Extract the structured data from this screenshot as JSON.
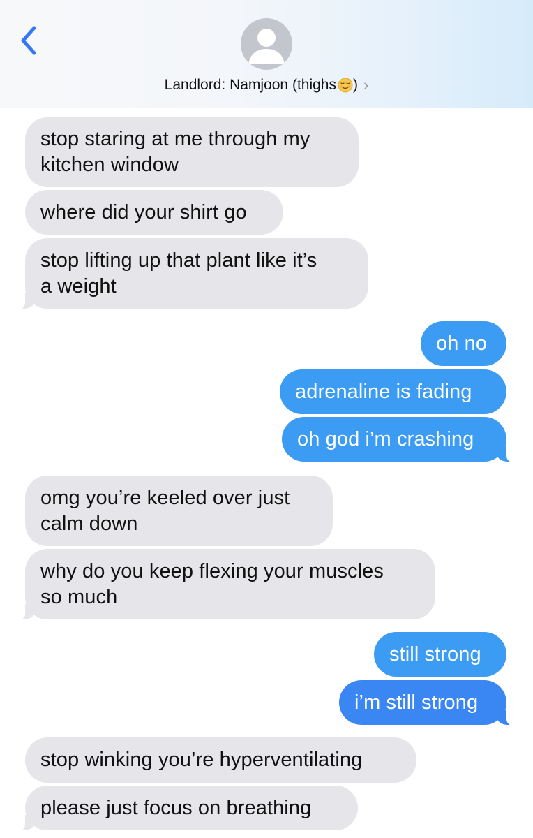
{
  "header": {
    "back_icon": "chevron-left-icon",
    "avatar_icon": "person-silhouette-icon",
    "contact_name": "Landlord: Namjoon (thighs",
    "contact_suffix": ")",
    "emoji": "relieved-face-emoji",
    "disclosure_icon": "chevron-right-icon",
    "disclosure_glyph": "›",
    "accent_color": "#3478f6"
  },
  "messages": [
    {
      "direction": "received",
      "text": "stop staring at me through my\nkitchen window"
    },
    {
      "direction": "received",
      "text": "where did your shirt go"
    },
    {
      "direction": "received",
      "text": "stop lifting up that plant like it’s\na weight"
    },
    {
      "direction": "sent",
      "text": "oh no"
    },
    {
      "direction": "sent",
      "text": "adrenaline is fading"
    },
    {
      "direction": "sent",
      "text": "oh god i’m crashing"
    },
    {
      "direction": "received",
      "text": "omg you’re keeled over just\ncalm down"
    },
    {
      "direction": "received",
      "text": "why do you keep flexing your muscles\nso much"
    },
    {
      "direction": "sent",
      "text": "still strong"
    },
    {
      "direction": "sent",
      "text": "i’m still strong"
    },
    {
      "direction": "received",
      "text": "stop winking you’re hyperventilating"
    },
    {
      "direction": "received",
      "text": "please just focus on breathing"
    }
  ],
  "colors": {
    "sent_bubble": "#3c9cf3",
    "received_bubble": "#e6e5ea",
    "sent_text": "#ffffff",
    "received_text": "#111111"
  }
}
